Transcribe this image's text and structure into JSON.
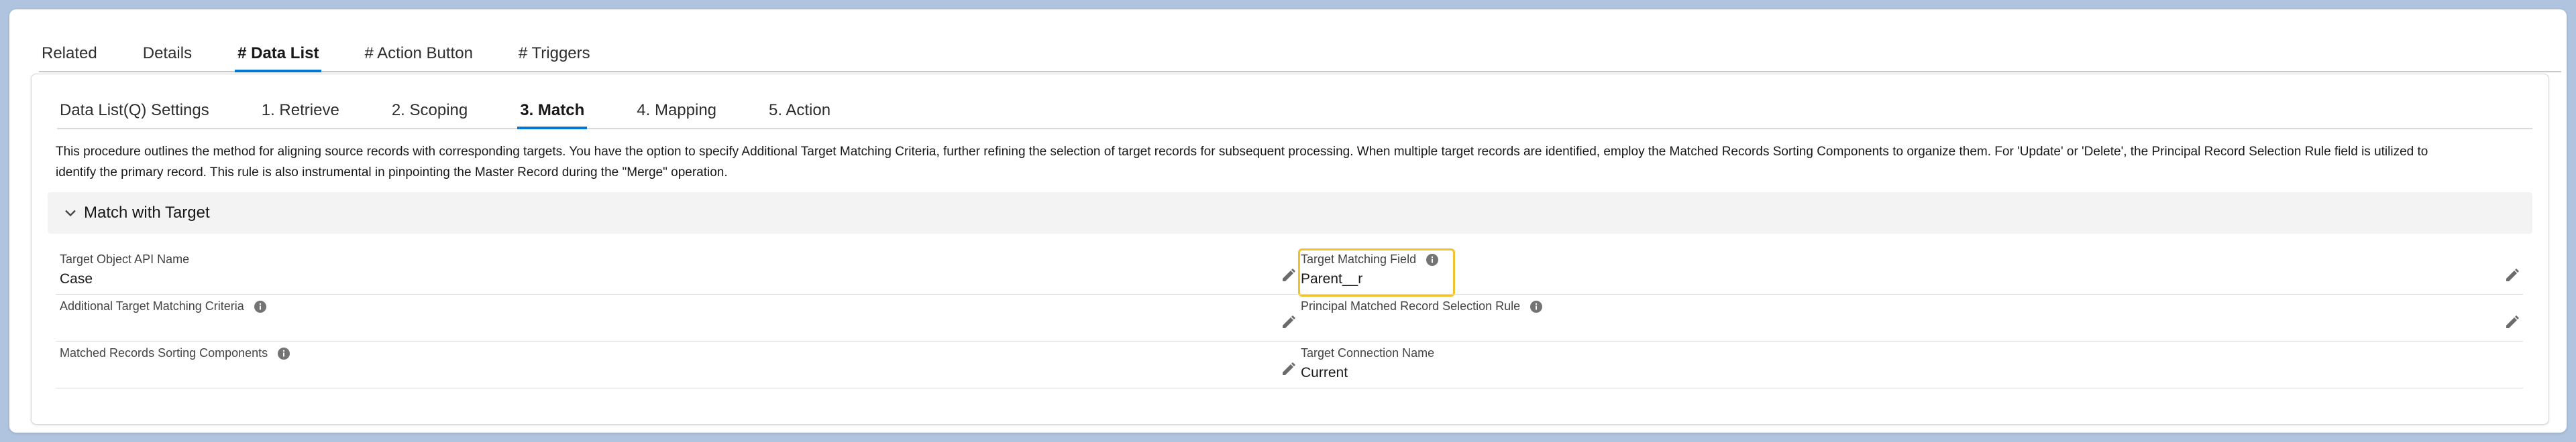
{
  "top_tabs": [
    {
      "label": "Related",
      "active": false
    },
    {
      "label": "Details",
      "active": false
    },
    {
      "label": "# Data List",
      "active": true
    },
    {
      "label": "# Action Button",
      "active": false
    },
    {
      "label": "# Triggers",
      "active": false
    }
  ],
  "sub_tabs": [
    {
      "label": "Data List(Q) Settings",
      "active": false
    },
    {
      "label": "1. Retrieve",
      "active": false
    },
    {
      "label": "2. Scoping",
      "active": false
    },
    {
      "label": "3. Match",
      "active": true
    },
    {
      "label": "4. Mapping",
      "active": false
    },
    {
      "label": "5. Action",
      "active": false
    }
  ],
  "description": {
    "line1": "This procedure outlines the method for aligning source records with corresponding targets. You have the option to specify Additional Target Matching Criteria, further refining the selection of target records for subsequent processing. When multiple target records are identified, employ the Matched Records Sorting Components to organize them. For 'Update' or 'Delete', the Principal Record Selection Rule field is utilized to",
    "line2": "identify the primary record. This rule is also instrumental in pinpointing the Master Record during the \"Merge\" operation."
  },
  "section": {
    "title": "Match with Target",
    "icon": "chevron-down-icon"
  },
  "fields": {
    "target_object": {
      "label": "Target Object API Name",
      "value": "Case"
    },
    "additional_criteria": {
      "label": "Additional Target Matching Criteria",
      "value": ""
    },
    "sorting_components": {
      "label": "Matched Records Sorting Components",
      "value": ""
    },
    "target_matching_field": {
      "label": "Target Matching Field",
      "value": "Parent__r"
    },
    "principal_rule": {
      "label": "Principal Matched Record Selection Rule",
      "value": ""
    },
    "target_connection": {
      "label": "Target Connection Name",
      "value": "Current"
    }
  },
  "colors": {
    "accent": "#0176d3",
    "highlight": "#f2c12e",
    "background": "#b0c4df"
  }
}
